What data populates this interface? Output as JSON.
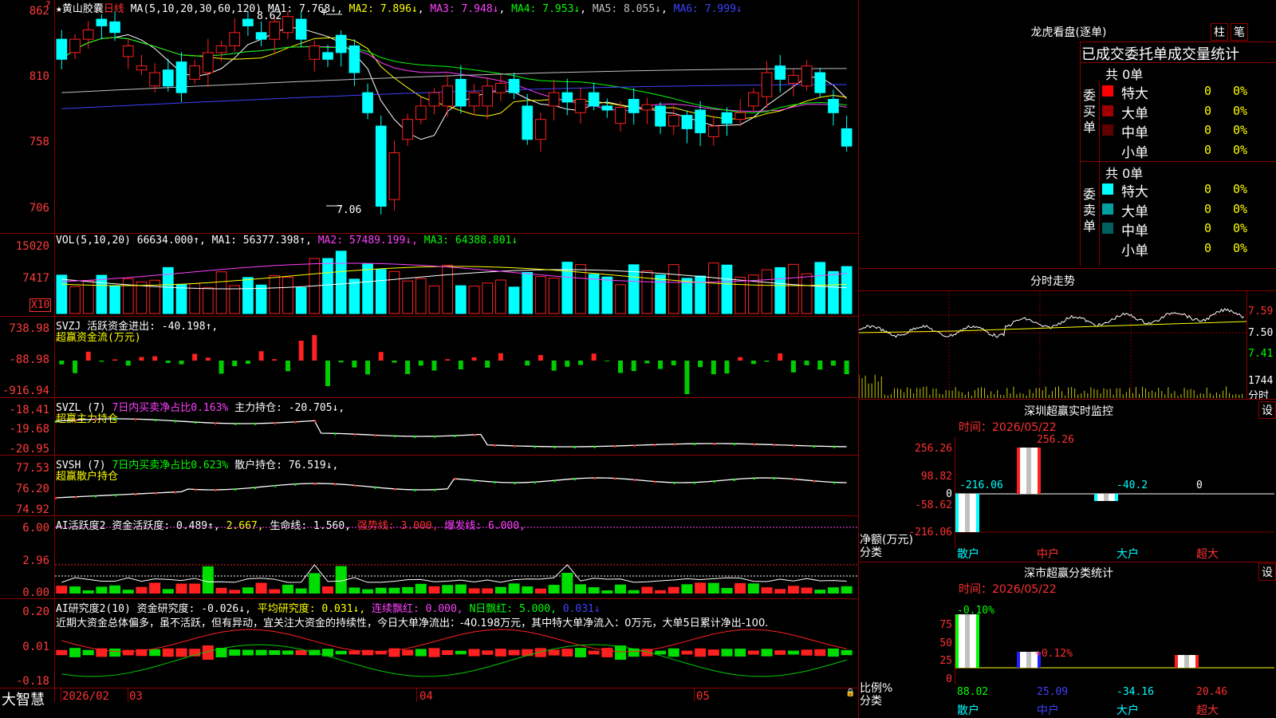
{
  "chart_data": {
    "type": "candlestick",
    "title": "黄山胶囊",
    "period": "日线",
    "price_axis": [
      "862",
      "810",
      "758",
      "706"
    ],
    "high_marker": "8.62",
    "low_marker": "7.06",
    "x_labels": [
      "2026/02",
      "03",
      "04",
      "05"
    ]
  },
  "header": {
    "star": "★",
    "stock_name": "黄山胶囊",
    "period": "日线",
    "ma_label": "MA(5,10,20,30,60,120)",
    "ma1": "MA1: 7.768↓",
    "ma2": "MA2: 7.896↓",
    "ma3": "MA3: 7.948↓",
    "ma4": "MA4: 7.953↓",
    "ma5": "MA5: 8.055↓",
    "ma6": "MA6: 7.999↓",
    "question": "?"
  },
  "vol": {
    "label": "VOL(5,10,20)",
    "value": "66634.000↑,",
    "ma1": "MA1: 56377.398↑,",
    "ma2": "MA2: 57489.199↓,",
    "ma3": "MA3: 64388.801↓",
    "axis": [
      "15020",
      "7417"
    ],
    "unit": "X10"
  },
  "svzj": {
    "label": "SVZJ",
    "text": "活跃资金进出: -40.198↑,",
    "sub": "超赢资金流(万元)",
    "axis": [
      "738.98",
      "-88.98",
      "-916.94"
    ]
  },
  "svzl": {
    "label": "SVZL (7)",
    "text1": "7日内买卖净占比0.163%",
    "text2": "主力持仓: -20.705↓,",
    "sub": "超赢主力持仓",
    "axis": [
      "-18.41",
      "-19.68",
      "-20.95"
    ]
  },
  "svsh": {
    "label": "SVSH (7)",
    "text1": "7日内买卖净占比0.623%",
    "text2": "散户持仓: 76.519↓,",
    "sub": "超赢散户持仓",
    "axis": [
      "77.53",
      "76.20",
      "74.92"
    ]
  },
  "ai1": {
    "label": "AI活跃度2",
    "text": "资金活跃度: 0.489↑,",
    "v2": "2.667,",
    "life": "生命线: 1.560,",
    "strong": "强势线: 3.000,",
    "burst": "爆发线: 6.000,",
    "axis": [
      "6.00",
      "2.96",
      "0.00"
    ]
  },
  "ai2": {
    "label": "AI研究度2(10)",
    "text": "资金研究度: -0.026↓,",
    "avg": "平均研究度: 0.031↓,",
    "cont": "连续飘红: 0.000,",
    "nday": "N日飘红: 5.000,",
    "last": "0.031↓",
    "axis": [
      "0.20",
      "0.01",
      "-0.18"
    ],
    "desc": "近期大资金总体偏多，虽不活跃，但有异动，宜关注大资金的持续性，今日大单净流出：-40.198万元，其中特大单净流入：0万元，大单5日累计净出-100."
  },
  "footer": {
    "brand": "大智慧",
    "dates": [
      "2026/02",
      "03",
      "04",
      "05"
    ]
  },
  "dragon": {
    "title": "龙虎看盘(逐单)",
    "btn1": "柱",
    "btn2": "笔",
    "tabs": "已成交委托单成交量统计",
    "buy_label": "委买单",
    "sell_label": "委卖单",
    "buy_total": "共 0单",
    "sell_total": "共 0单",
    "buy_rows": [
      {
        "name": "特大",
        "count": "0",
        "pct": "0%",
        "color": "#ff0000"
      },
      {
        "name": "大单",
        "count": "0",
        "pct": "0%",
        "color": "#a00000"
      },
      {
        "name": "中单",
        "count": "0",
        "pct": "0%",
        "color": "#600000"
      },
      {
        "name": "小单",
        "count": "0",
        "pct": "0%",
        "color": "#000000"
      }
    ],
    "sell_rows": [
      {
        "name": "特大",
        "count": "0",
        "pct": "0%",
        "color": "#00ffff"
      },
      {
        "name": "大单",
        "count": "0",
        "pct": "0%",
        "color": "#00a0a0"
      },
      {
        "name": "中单",
        "count": "0",
        "pct": "0%",
        "color": "#006060"
      },
      {
        "name": "小单",
        "count": "0",
        "pct": "0%",
        "color": "#000000"
      }
    ]
  },
  "intraday": {
    "title": "分时走势",
    "axis": [
      "7.59",
      "7.50",
      "7.41"
    ],
    "vol_axis": "1744",
    "vol_unit": "分时"
  },
  "monitor": {
    "title": "深圳超赢实时监控",
    "settings": "设",
    "time": "时间：2026/05/22",
    "axis": [
      "256.26",
      "98.82",
      "0",
      "-58.62",
      "-216.06"
    ],
    "net_label": "净额(万元)",
    "cat_label": "分类",
    "categories": [
      "散户",
      "中户",
      "大户",
      "超大"
    ],
    "values": [
      "-216.06",
      "256.26",
      "-40.2",
      "0"
    ]
  },
  "classify": {
    "title": "深市超赢分类统计",
    "settings": "设",
    "time": "时间：2026/05/22",
    "axis": [
      "75",
      "50",
      "25",
      "0"
    ],
    "ratio_label": "比例%",
    "cat_label": "分类",
    "categories": [
      "散户",
      "中户",
      "大户",
      "超大"
    ],
    "top_labels": [
      "-0.10%",
      "+0.12%"
    ],
    "values": [
      "88.02",
      "25.09",
      "-34.16",
      "20.46"
    ]
  }
}
